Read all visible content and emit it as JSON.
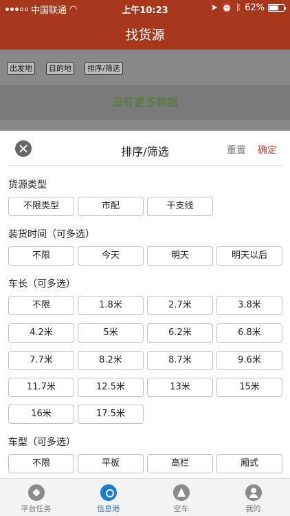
{
  "status": {
    "carrier": "中国联通",
    "time": "上午10:23",
    "battery": "62%",
    "battery_level": 0.62
  },
  "header": {
    "title": "找货源"
  },
  "filters": {
    "origin": "出发地",
    "destination": "目的地",
    "sort": "排序/筛选"
  },
  "list": {
    "empty_text": "没有更多数据"
  },
  "sheet": {
    "title": "排序/筛选",
    "reset": "重置",
    "confirm": "确定",
    "sections": [
      {
        "label": "货源类型",
        "options": [
          "不限类型",
          "市配",
          "干支线"
        ]
      },
      {
        "label": "装货时间（可多选）",
        "options": [
          "不限",
          "今天",
          "明天",
          "明天以后"
        ]
      },
      {
        "label": "车长（可多选）",
        "options": [
          "不限",
          "1.8米",
          "2.7米",
          "3.8米",
          "4.2米",
          "5米",
          "6.2米",
          "6.8米",
          "7.7米",
          "8.2米",
          "8.7米",
          "9.6米",
          "11.7米",
          "12.5米",
          "13米",
          "15米",
          "16米",
          "17.5米"
        ]
      },
      {
        "label": "车型（可多选）",
        "options": [
          "不限",
          "平板",
          "高栏",
          "厢式"
        ]
      }
    ]
  },
  "tabbar": {
    "items": [
      {
        "label": "平台任务",
        "icon": "compass-icon"
      },
      {
        "label": "信息港",
        "icon": "location-pin-icon"
      },
      {
        "label": "空车",
        "icon": "road-icon"
      },
      {
        "label": "我的",
        "icon": "user-icon"
      }
    ],
    "active_color": "#1a7bd6"
  },
  "colors": {
    "header": "#a8381c",
    "confirm": "#d44434",
    "empty_text": "#4f7f2f"
  }
}
